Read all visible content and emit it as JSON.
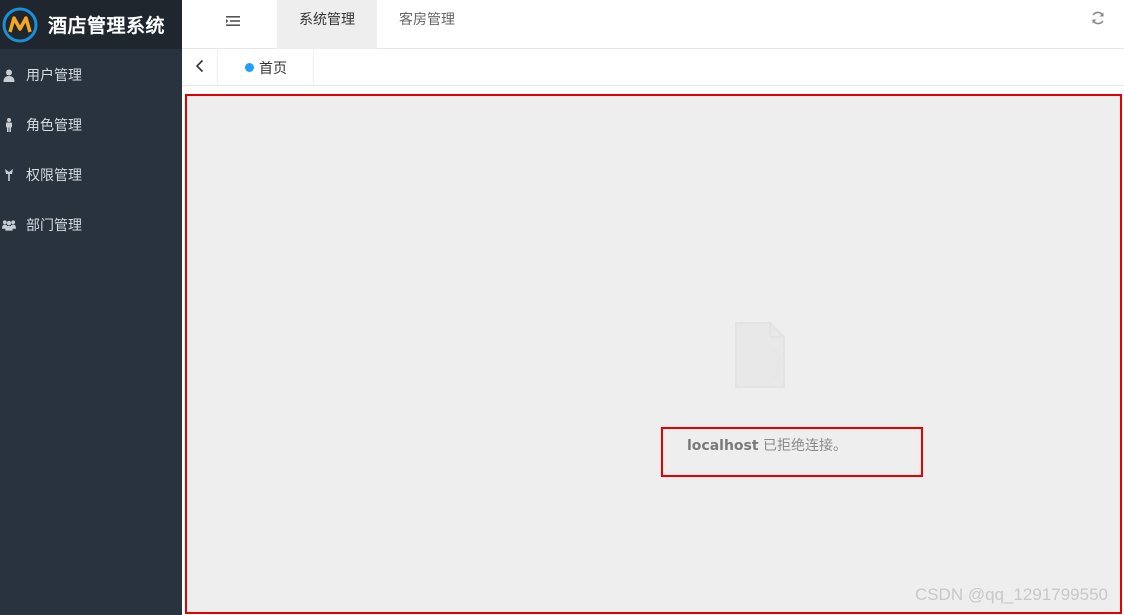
{
  "app": {
    "title": "酒店管理系统"
  },
  "sidebar": {
    "items": [
      {
        "label": "用户管理",
        "icon": "user-icon"
      },
      {
        "label": "角色管理",
        "icon": "person-icon"
      },
      {
        "label": "权限管理",
        "icon": "permission-icon"
      },
      {
        "label": "部门管理",
        "icon": "group-icon"
      }
    ]
  },
  "header": {
    "tabs": [
      {
        "label": "系统管理",
        "active": true
      },
      {
        "label": "客房管理",
        "active": false
      }
    ],
    "refresh_icon": "refresh-icon",
    "menu_toggle_icon": "menu-toggle-icon"
  },
  "tabstrip": {
    "back_icon": "chevron-left-icon",
    "tabs": [
      {
        "label": "首页",
        "active": true
      }
    ]
  },
  "content": {
    "error_host": "localhost",
    "error_message": " 已拒绝连接。"
  },
  "watermark": "CSDN @qq_1291799550",
  "colors": {
    "sidebar_bg": "#28333e",
    "logo_bg": "#20262d",
    "active_tab_bg": "#eeeeee",
    "tab_dot": "#1e9fff",
    "highlight_border": "#e60000"
  }
}
